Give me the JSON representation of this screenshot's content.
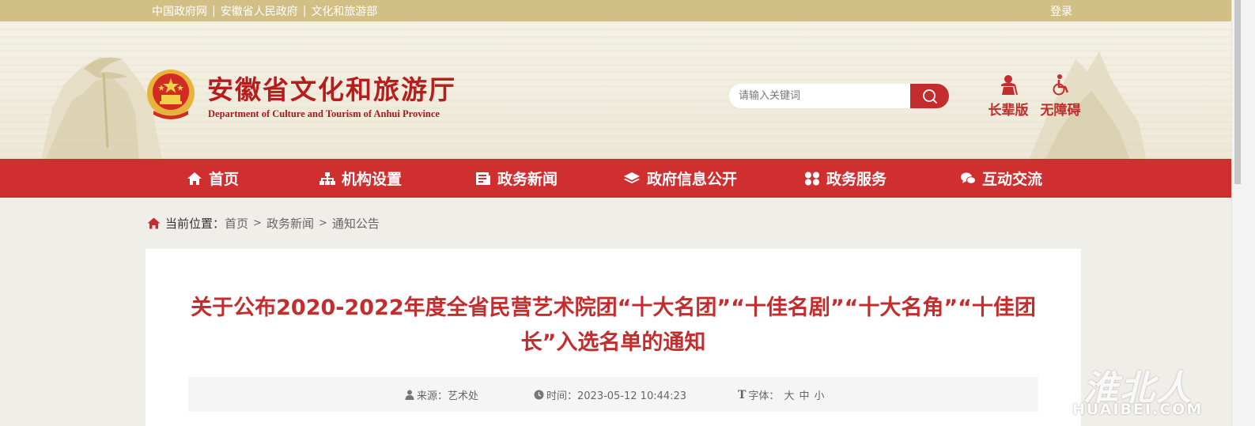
{
  "topbar": {
    "links": [
      "中国政府网",
      "安徽省人民政府",
      "文化和旅游部"
    ],
    "separator": "|",
    "login": "登录"
  },
  "header": {
    "title": "安徽省文化和旅游厅",
    "subtitle": "Department of Culture and Tourism of Anhui Province",
    "search_placeholder": "请输入关键词",
    "tools": [
      {
        "label": "长辈版",
        "icon": "elder-icon"
      },
      {
        "label": "无障碍",
        "icon": "wheelchair-icon"
      }
    ]
  },
  "nav": {
    "items": [
      {
        "label": "首页",
        "icon": "home-icon"
      },
      {
        "label": "机构设置",
        "icon": "org-chart-icon"
      },
      {
        "label": "政务新闻",
        "icon": "news-icon"
      },
      {
        "label": "政府信息公开",
        "icon": "layers-icon"
      },
      {
        "label": "政务服务",
        "icon": "grid-icon"
      },
      {
        "label": "互动交流",
        "icon": "chat-icon"
      }
    ]
  },
  "breadcrumb": {
    "label": "当前位置：",
    "items": [
      "首页",
      "政务新闻",
      "通知公告"
    ],
    "arrow": ">"
  },
  "article": {
    "title": "关于公布2020-2022年度全省民营艺术院团“十大名团”“十佳名剧”“十大名角”“十佳团长”入选名单的通知",
    "source": "来源：艺术处",
    "time": "时间：2023-05-12 10:44:23",
    "font_label": "字体：",
    "font_sizes": [
      "大",
      "中",
      "小"
    ]
  },
  "watermark": {
    "cn": "淮北人",
    "en": "HUAIBEI.COM"
  },
  "colors": {
    "topbar": "#d2bf86",
    "brand_red": "#cf2f2f",
    "title_red": "#c42d2d"
  }
}
